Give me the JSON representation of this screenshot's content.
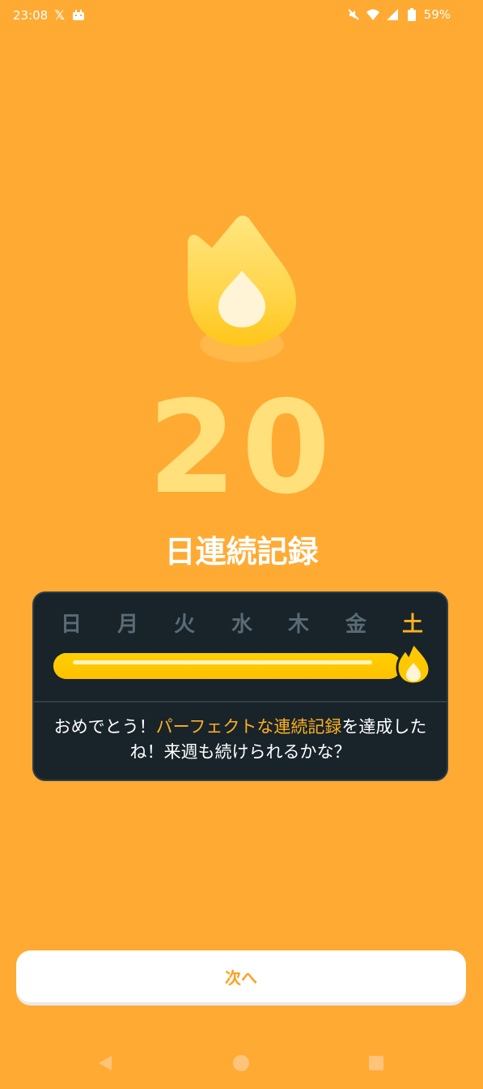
{
  "status": {
    "time": "23:08",
    "x_icon": "x-logo-icon",
    "app_icon": "notification-app-icon",
    "battery": "59%",
    "icons": [
      "mute-icon",
      "wifi-icon",
      "signal-icon",
      "battery-icon"
    ]
  },
  "streak": {
    "count": "20",
    "label": "日連続記録"
  },
  "week": {
    "days": [
      "日",
      "月",
      "火",
      "水",
      "木",
      "金",
      "土"
    ],
    "today_index": 6,
    "progress": 1.0
  },
  "message": {
    "prefix": "おめでとう！",
    "highlight": "パーフェクトな連続記録",
    "suffix": "を達成したね！来週も続けられるかな？"
  },
  "buttons": {
    "next_label": "次へ"
  },
  "colors": {
    "background": "#ffaa33",
    "card": "#18232a",
    "accent": "#ffb020",
    "flame": "#ffd000"
  },
  "nav": {
    "icons": [
      "back-icon",
      "home-icon",
      "recents-icon"
    ]
  }
}
